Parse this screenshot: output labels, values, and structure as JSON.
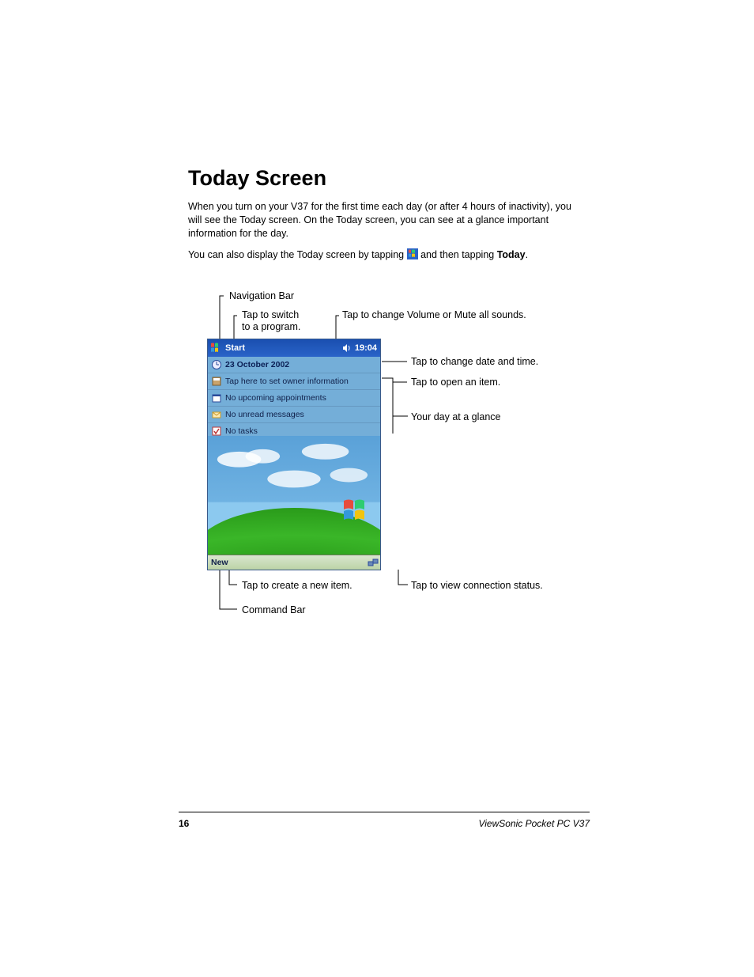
{
  "heading": "Today Screen",
  "para1": "When you turn on your V37 for the first time each day (or after 4 hours of inactivity), you will see the Today screen. On the Today screen, you can see at a glance important information for the day.",
  "para2_a": "You can also display the Today screen by tapping ",
  "para2_b": " and then tapping ",
  "para2_bold": "Today",
  "para2_c": ".",
  "callouts": {
    "nav_bar": "Navigation Bar",
    "switch_prog_l1": "Tap to switch",
    "switch_prog_l2": "to a program.",
    "volume": "Tap to change Volume or Mute all sounds.",
    "date_time": "Tap to change date and time.",
    "open_item": "Tap to open an item.",
    "glance": "Your day at a glance",
    "new_item": "Tap to create a new item.",
    "conn_status": "Tap to view connection status.",
    "cmd_bar": "Command Bar"
  },
  "device": {
    "start_label": "Start",
    "clock": "19:04",
    "rows": {
      "date": "23 October 2002",
      "owner": "Tap here to set owner information",
      "appts": "No upcoming appointments",
      "msgs": "No unread messages",
      "tasks": "No tasks"
    },
    "new_label": "New"
  },
  "footer": {
    "page": "16",
    "product": "ViewSonic  Pocket PC   V37"
  }
}
